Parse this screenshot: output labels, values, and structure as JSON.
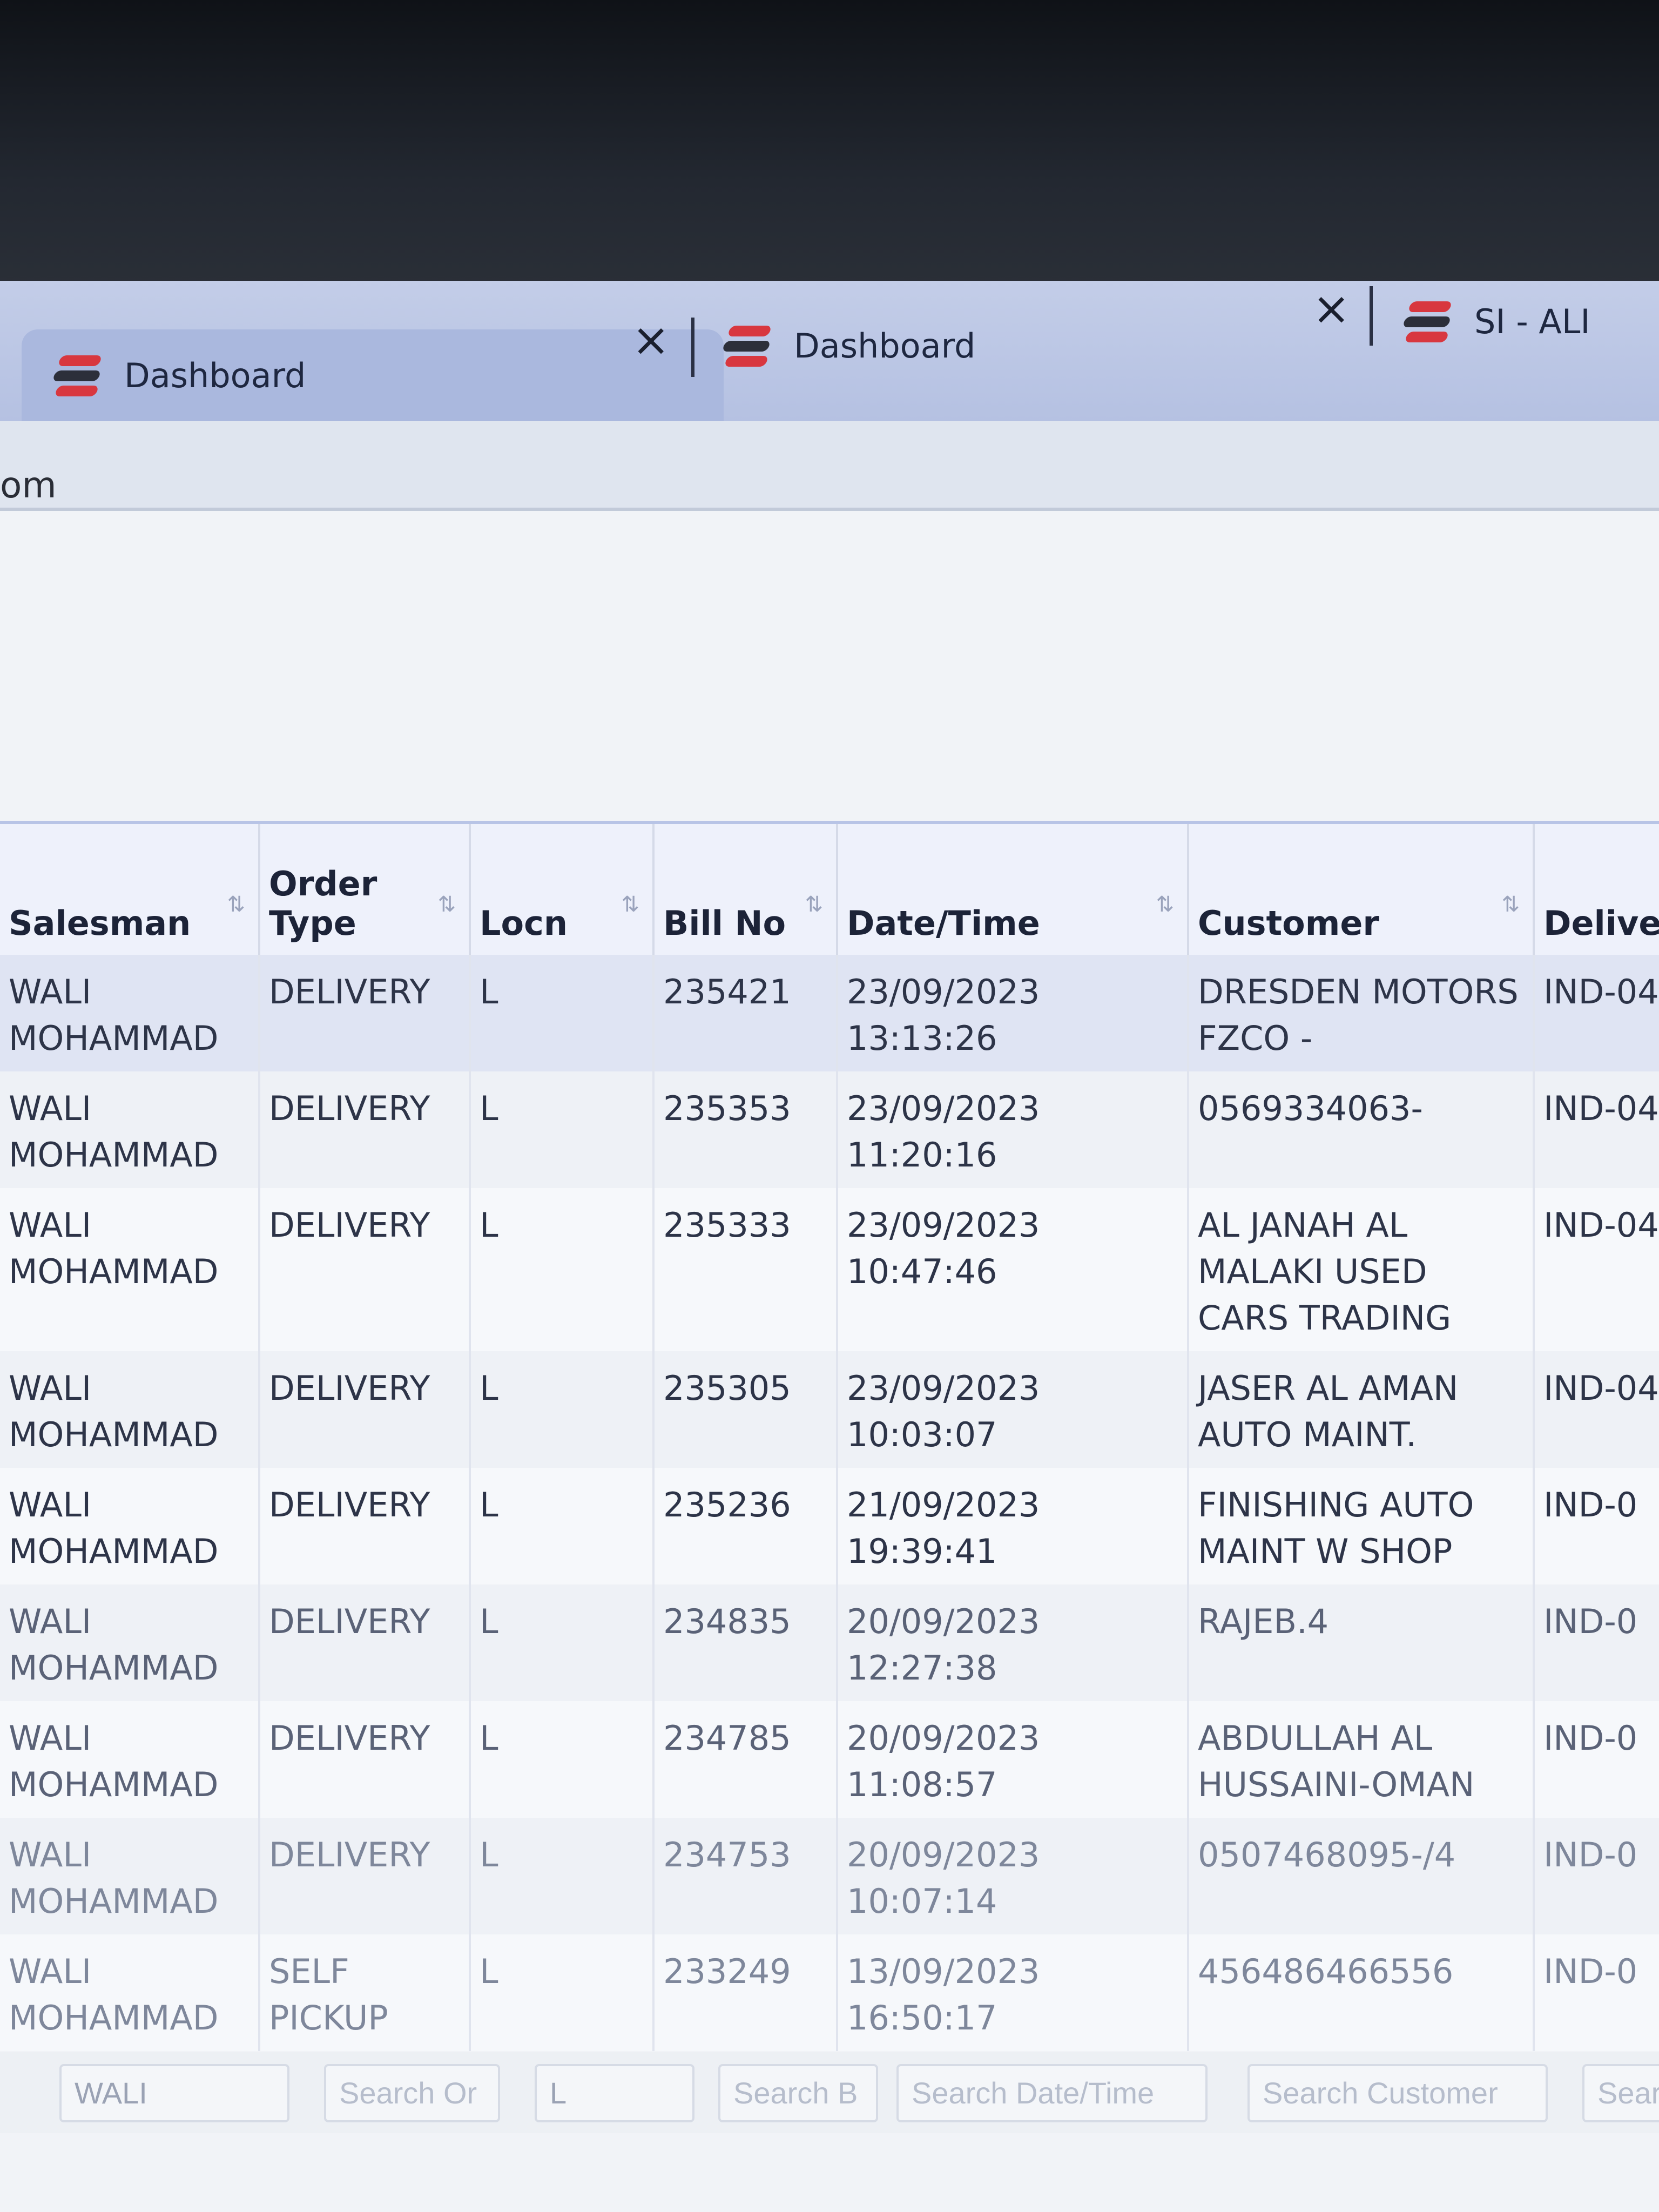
{
  "tabs": [
    {
      "label": "Dashboard",
      "active": true,
      "logo": "app-logo-icon",
      "close": "×"
    },
    {
      "label": "Dashboard",
      "active": false,
      "logo": "app-logo-icon",
      "close": "×"
    },
    {
      "label": "SI - ALI",
      "active": false,
      "logo": "app-logo-icon"
    }
  ],
  "address_fragment": "om",
  "columns": [
    {
      "label": "Salesman",
      "sort": "⇅"
    },
    {
      "label": "Order Type",
      "sort": "⇅"
    },
    {
      "label": "Locn",
      "sort": "⇅"
    },
    {
      "label": "Bill No",
      "sort": "⇅"
    },
    {
      "label": "Date/Time",
      "sort": "⇅"
    },
    {
      "label": "Customer",
      "sort": "⇅"
    },
    {
      "label": "Deliver"
    }
  ],
  "rows": [
    [
      "WALI MOHAMMAD",
      "DELIVERY",
      "L",
      "235421",
      "23/09/2023 13:13:26",
      "DRESDEN MOTORS FZCO -",
      "IND-04"
    ],
    [
      "WALI MOHAMMAD",
      "DELIVERY",
      "L",
      "235353",
      "23/09/2023 11:20:16",
      "0569334063-",
      "IND-04"
    ],
    [
      "WALI MOHAMMAD",
      "DELIVERY",
      "L",
      "235333",
      "23/09/2023 10:47:46",
      "AL JANAH AL MALAKI USED CARS TRADING",
      "IND-04"
    ],
    [
      "WALI MOHAMMAD",
      "DELIVERY",
      "L",
      "235305",
      "23/09/2023 10:03:07",
      "JASER AL AMAN AUTO MAINT.",
      "IND-04"
    ],
    [
      "WALI MOHAMMAD",
      "DELIVERY",
      "L",
      "235236",
      "21/09/2023 19:39:41",
      "FINISHING AUTO MAINT W SHOP",
      "IND-0"
    ],
    [
      "WALI MOHAMMAD",
      "DELIVERY",
      "L",
      "234835",
      "20/09/2023 12:27:38",
      "RAJEB.4",
      "IND-0"
    ],
    [
      "WALI MOHAMMAD",
      "DELIVERY",
      "L",
      "234785",
      "20/09/2023 11:08:57",
      "ABDULLAH AL HUSSAINI-OMAN",
      "IND-0"
    ],
    [
      "WALI MOHAMMAD",
      "DELIVERY",
      "L",
      "234753",
      "20/09/2023 10:07:14",
      "0507468095-/4",
      "IND-0"
    ],
    [
      "WALI MOHAMMAD",
      "SELF PICKUP",
      "L",
      "233249",
      "13/09/2023 16:50:17",
      "456486466556",
      "IND-0"
    ]
  ],
  "filters": {
    "salesman": "WALI",
    "order_type_placeholder": "Search Or",
    "locn": "L",
    "bill_no_placeholder": "Search B",
    "datetime_placeholder": "Search Date/Time",
    "customer_placeholder": "Search Customer",
    "deliver_placeholder": "Sear"
  }
}
